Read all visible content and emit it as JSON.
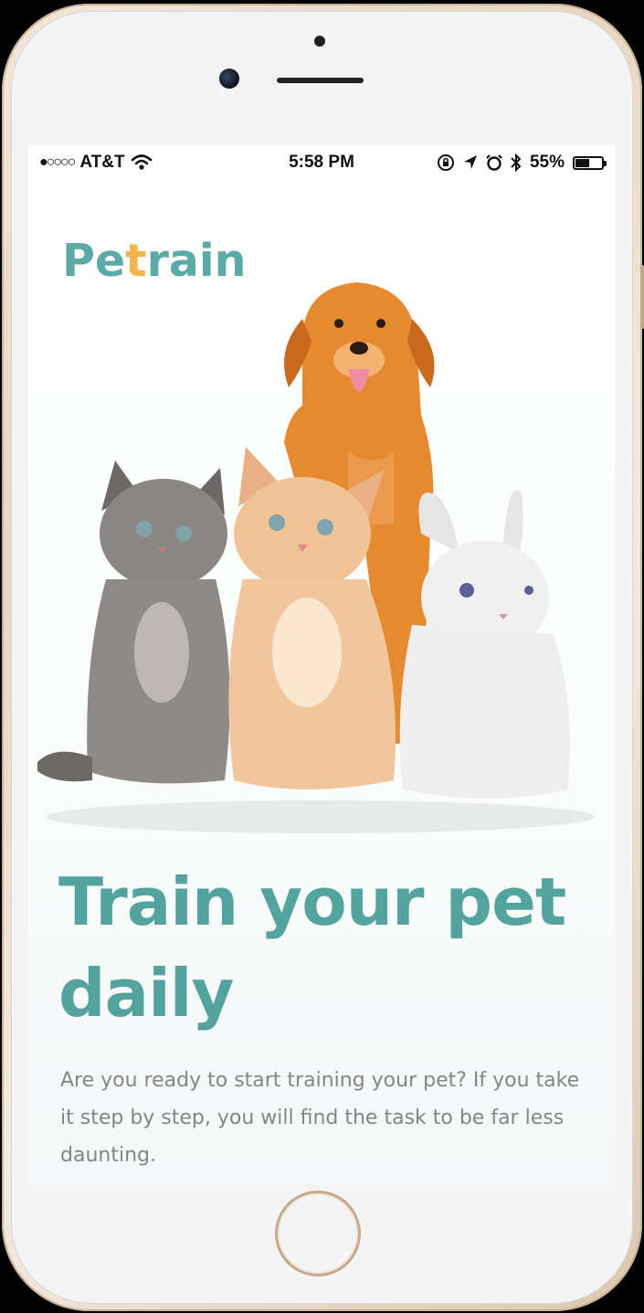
{
  "status_bar": {
    "signal": "●○○○○",
    "carrier": "AT&T",
    "time": "5:58 PM",
    "battery_percent": "55%",
    "battery_level": 0.55,
    "icons": [
      "wifi-icon",
      "orientation-lock-icon",
      "location-icon",
      "alarm-icon",
      "bluetooth-icon",
      "battery-icon"
    ]
  },
  "app": {
    "brand": {
      "part1": "Pe",
      "part2": "t",
      "part3": "rain"
    },
    "hero_image": "pets-group-dog-cats-rabbit",
    "headline": "Train your pet daily",
    "description": "Are you ready to start training your pet? If you take it step by step, you will find the task to be far less daunting."
  },
  "colors": {
    "accent_teal": "#53a39f",
    "accent_orange": "#f5b44a",
    "body_text": "#858585"
  }
}
